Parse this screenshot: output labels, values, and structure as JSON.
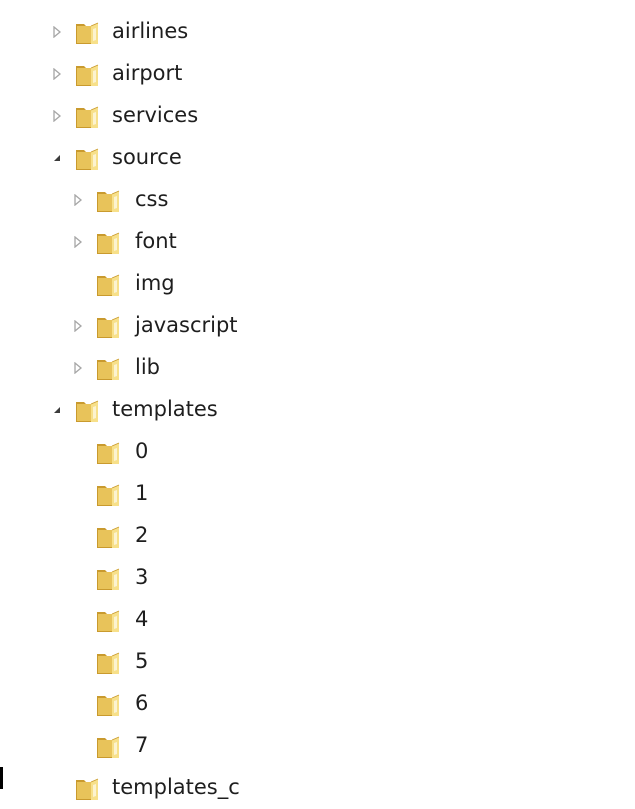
{
  "tree": {
    "items": [
      {
        "label": "airlines",
        "state": "collapsed",
        "depth": 0
      },
      {
        "label": "airport",
        "state": "collapsed",
        "depth": 0
      },
      {
        "label": "services",
        "state": "collapsed",
        "depth": 0
      },
      {
        "label": "source",
        "state": "expanded",
        "depth": 0
      },
      {
        "label": "css",
        "state": "collapsed",
        "depth": 1
      },
      {
        "label": "font",
        "state": "collapsed",
        "depth": 1
      },
      {
        "label": "img",
        "state": "none",
        "depth": 1
      },
      {
        "label": "javascript",
        "state": "collapsed",
        "depth": 1
      },
      {
        "label": "lib",
        "state": "collapsed",
        "depth": 1
      },
      {
        "label": "templates",
        "state": "expanded",
        "depth": 0
      },
      {
        "label": "0",
        "state": "none",
        "depth": 1
      },
      {
        "label": "1",
        "state": "none",
        "depth": 1
      },
      {
        "label": "2",
        "state": "none",
        "depth": 1
      },
      {
        "label": "3",
        "state": "none",
        "depth": 1
      },
      {
        "label": "4",
        "state": "none",
        "depth": 1
      },
      {
        "label": "5",
        "state": "none",
        "depth": 1
      },
      {
        "label": "6",
        "state": "none",
        "depth": 1
      },
      {
        "label": "7",
        "state": "none",
        "depth": 1
      },
      {
        "label": "templates_c",
        "state": "none",
        "depth": 0
      }
    ]
  },
  "colors": {
    "folder_light": "#f7e08a",
    "folder_mid": "#e8c35a",
    "folder_dark": "#c99a2e",
    "arrow_collapsed": "#a6a6a6",
    "arrow_expanded": "#3c3c3c",
    "text": "#1e1e1e"
  }
}
